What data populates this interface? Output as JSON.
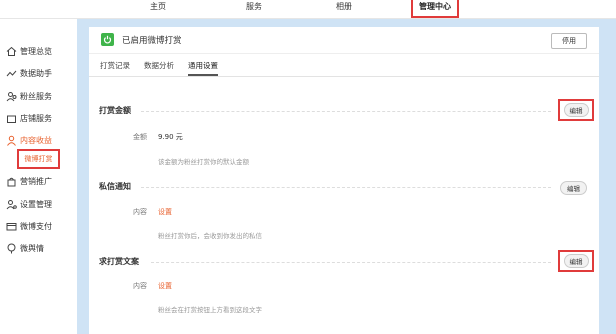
{
  "top_nav": {
    "tabs": [
      {
        "label": "主页"
      },
      {
        "label": "服务"
      },
      {
        "label": "相册"
      },
      {
        "label": "管理中心"
      }
    ]
  },
  "sidebar": {
    "items": [
      {
        "label": "管理总览",
        "icon": "home-icon"
      },
      {
        "label": "数据助手",
        "icon": "trend-icon"
      },
      {
        "label": "粉丝服务",
        "icon": "fans-icon"
      },
      {
        "label": "店铺服务",
        "icon": "shop-icon"
      },
      {
        "label": "内容收益",
        "icon": "user-icon"
      },
      {
        "label": "营销推广",
        "icon": "bag-icon"
      },
      {
        "label": "设置管理",
        "icon": "settings-user-icon"
      },
      {
        "label": "微博支付",
        "icon": "card-icon"
      },
      {
        "label": "微舆情",
        "icon": "sentiment-icon"
      }
    ],
    "sub_item": {
      "label": "微博打赏"
    }
  },
  "header": {
    "title": "已启用微博打赏",
    "stop_label": "停用"
  },
  "tabs": [
    {
      "label": "打赏记录"
    },
    {
      "label": "数据分析"
    },
    {
      "label": "通用设置"
    }
  ],
  "sections": {
    "amount": {
      "title": "打赏金额",
      "edit_label": "编辑",
      "field_label": "金额",
      "field_value": "9.90 元",
      "hint": "该金额为粉丝打赏你的默认金额"
    },
    "private": {
      "title": "私信通知",
      "edit_label": "编辑",
      "field_label": "内容",
      "field_value": "设置",
      "hint": "粉丝打赏你后，会收到你发出的私信"
    },
    "request": {
      "title": "求打赏文案",
      "edit_label": "编辑",
      "field_label": "内容",
      "field_value": "设置",
      "hint": "粉丝会在打赏按钮上方看到这段文字"
    }
  },
  "colors": {
    "accent": "#e8602d",
    "highlight_box": "#e03b3b",
    "background_band": "#cfe3f5",
    "app_icon": "#3fb44a"
  }
}
